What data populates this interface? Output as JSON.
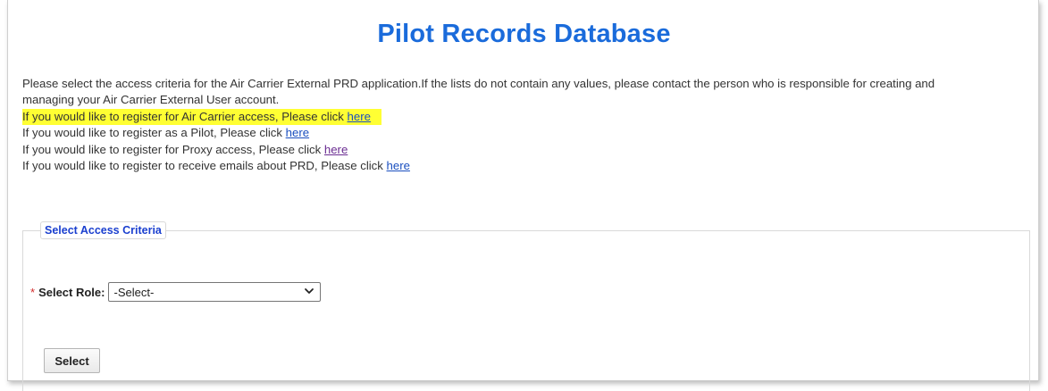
{
  "page": {
    "title": "Pilot Records Database"
  },
  "intro": {
    "line1": "Please select the access criteria for the Air Carrier External PRD application.If the lists do not contain any values, please contact the person who is responsible for creating and",
    "line2": "managing your Air Carrier External User account.",
    "register_lines": [
      {
        "text": "If you would like to register for Air Carrier access, Please click ",
        "link": "here",
        "highlighted": true
      },
      {
        "text": "If you would like to register as a Pilot, Please click ",
        "link": "here",
        "highlighted": false
      },
      {
        "text": "If you would like to register for Proxy access, Please click ",
        "link": "here",
        "highlighted": false
      },
      {
        "text": "If you would like to register to receive emails about PRD, Please click ",
        "link": "here",
        "highlighted": false
      }
    ]
  },
  "criteria": {
    "legend": "Select Access Criteria",
    "required_marker": "*",
    "role_label": "Select Role:",
    "role_value": "-Select-",
    "select_button": "Select"
  },
  "colors": {
    "title": "#1a6bdb",
    "legend": "#1a3fcf",
    "highlight": "#ffff33",
    "link": "#1a4fbf",
    "required": "#d22b2b"
  }
}
